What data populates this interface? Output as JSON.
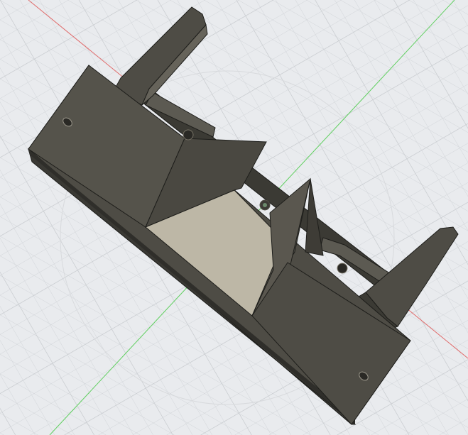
{
  "viewport": {
    "background_color": "#e9ebee",
    "grid_minor_color": "#d3d6da",
    "grid_major_color": "#bfc3c8",
    "x_axis_color": "#e06b6b",
    "y_axis_color": "#5fcf5f"
  },
  "model": {
    "body_color": "#4e4c45",
    "body_dark_color": "#3b3a34",
    "body_light_color": "#6b685f",
    "inner_face_color": "#bdb7a6",
    "edge_color": "#1e1e1b"
  }
}
